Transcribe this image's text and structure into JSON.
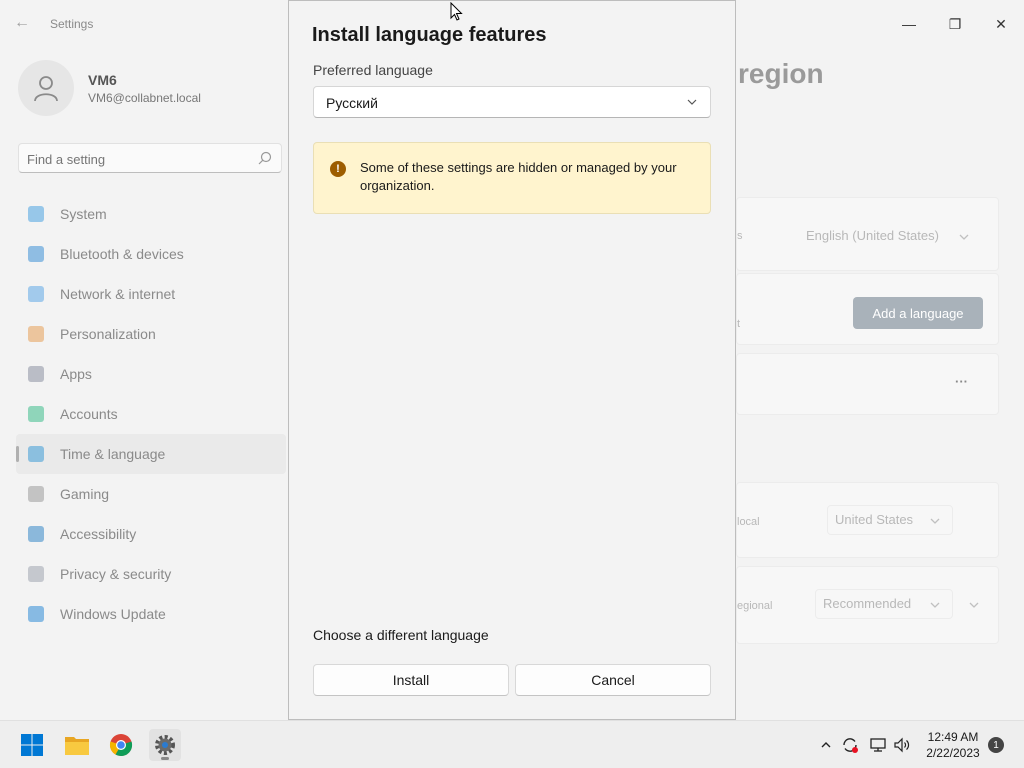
{
  "window": {
    "title": "Settings",
    "back_glyph": "←",
    "minimize_glyph": "—",
    "maximize_glyph": "❐",
    "close_glyph": "✕"
  },
  "profile": {
    "name": "VM6",
    "email": "VM6@collabnet.local"
  },
  "search": {
    "placeholder": "Find a setting",
    "icon": "search-icon"
  },
  "nav": {
    "items": [
      {
        "label": "System",
        "icon": "system-icon",
        "color": "#4aa3e0"
      },
      {
        "label": "Bluetooth & devices",
        "icon": "bluetooth-icon",
        "color": "#3c8fd6"
      },
      {
        "label": "Network & internet",
        "icon": "wifi-icon",
        "color": "#5fa8e6"
      },
      {
        "label": "Personalization",
        "icon": "brush-icon",
        "color": "#e59f55"
      },
      {
        "label": "Apps",
        "icon": "apps-icon",
        "color": "#8a8fa0"
      },
      {
        "label": "Accounts",
        "icon": "accounts-icon",
        "color": "#3dbb8a"
      },
      {
        "label": "Time & language",
        "icon": "time-language-icon",
        "color": "#3c9ad6"
      },
      {
        "label": "Gaming",
        "icon": "gaming-icon",
        "color": "#9a9a9a"
      },
      {
        "label": "Accessibility",
        "icon": "accessibility-icon",
        "color": "#3486c6"
      },
      {
        "label": "Privacy & security",
        "icon": "shield-icon",
        "color": "#9ea4ae"
      },
      {
        "label": "Windows Update",
        "icon": "update-icon",
        "color": "#2e8ad6"
      }
    ],
    "active_index": 6
  },
  "background_page": {
    "heading_fragment": "region",
    "row1_label_fragment": "s",
    "row1_value": "English (United States)",
    "row2_label_fragment": "t",
    "add_language_label": "Add a language",
    "more_glyph": "···",
    "row4_label_fragment": "local",
    "row4_value": "United States",
    "row5_label_fragment": "egional",
    "row5_value": "Recommended"
  },
  "dialog": {
    "title": "Install language features",
    "preferred_label": "Preferred language",
    "preferred_value": "Русский",
    "warning_glyph": "!",
    "warning_text": "Some of these settings are hidden or managed by your organization.",
    "choose_different": "Choose a different language",
    "install_label": "Install",
    "cancel_label": "Cancel"
  },
  "taskbar": {
    "apps": [
      "windows-start-icon",
      "file-explorer-icon",
      "chrome-icon",
      "settings-gear-icon"
    ],
    "tray_up_glyph": "^",
    "time": "12:49 AM",
    "date": "2/22/2023",
    "notification_count": "1"
  },
  "colors": {
    "accent": "#0067c0",
    "warning_bg": "#fff4ce",
    "warning_icon": "#9d5d00"
  }
}
